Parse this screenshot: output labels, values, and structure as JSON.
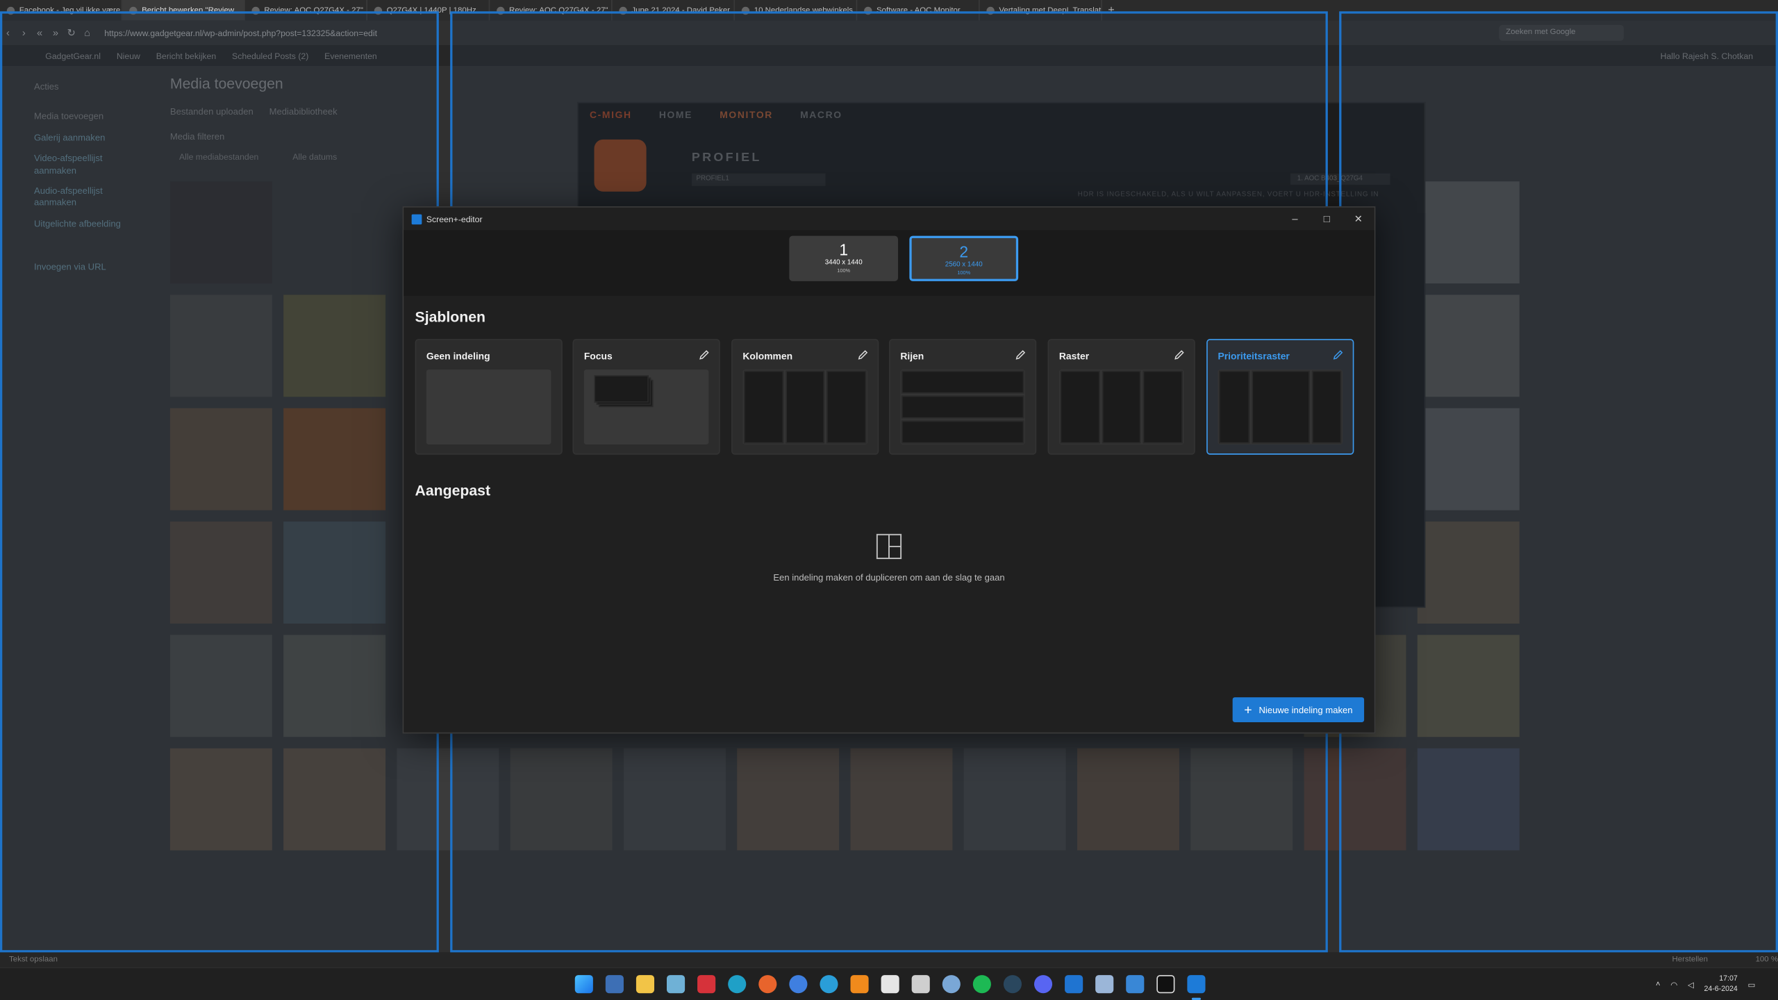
{
  "browser": {
    "tabs": [
      {
        "label": "Facebook - Jeg vil ikke være"
      },
      {
        "label": "Bericht bewerken \"Review"
      },
      {
        "label": "Review: AOC Q27G4X - 27\""
      },
      {
        "label": "Q27G4X | 1440P | 180Hz"
      },
      {
        "label": "Review: AOC Q27G4X - 27\""
      },
      {
        "label": "June 21 2024 - David Peker"
      },
      {
        "label": "10 Nederlandse webwinkels"
      },
      {
        "label": "Software - AOC Monitor"
      },
      {
        "label": "Vertaling met DeepL Translate"
      }
    ],
    "tab_add": "+",
    "url": "https://www.gadgetgear.nl/wp-admin/post.php?post=132325&action=edit",
    "search_placeholder": "Zoeken met Google"
  },
  "wp": {
    "bar_items": [
      "GadgetGear.nl",
      "Nieuw",
      "Bericht bekijken",
      "Scheduled Posts (2)",
      "Evenementen"
    ],
    "greeting": "Hallo Rajesh S. Chotkan",
    "sidebar": [
      "Acties",
      "Media toevoegen",
      "Galerij aanmaken",
      "Video-afspeellijst aanmaken",
      "Audio-afspeellijst aanmaken",
      "Uitgelichte afbeelding",
      "Invoegen via URL"
    ],
    "title": "Media toevoegen",
    "tabs": [
      "Bestanden uploaden",
      "Mediabibliotheek"
    ],
    "filter_label": "Media filteren",
    "filter_type": "Alle mediabestanden",
    "filter_date": "Alle datums",
    "status_left": "Tekst opslaan",
    "zoom_label": "Herstellen",
    "zoom_value": "100 %"
  },
  "bgapp": {
    "brand": "C-MIGH",
    "nav": [
      "HOME",
      "MONITOR",
      "MACRO"
    ],
    "profile_title": "PROFIEL",
    "profile_select": "PROFIEL1",
    "monitor_label": "1. AOC B403_Q27G4",
    "note": "HDR IS INGESCHAKELD, ALS U WILT AANPASSEN, VOERT U HDR-INSTELLING IN"
  },
  "editor": {
    "window_title": "Screen+-editor",
    "monitors": [
      {
        "number": "1",
        "resolution": "3440 x 1440",
        "scale": "100%"
      },
      {
        "number": "2",
        "resolution": "2560 x 1440",
        "scale": "100%"
      }
    ],
    "templates_heading": "Sjablonen",
    "templates": [
      {
        "name": "Geen indeling"
      },
      {
        "name": "Focus"
      },
      {
        "name": "Kolommen"
      },
      {
        "name": "Rijen"
      },
      {
        "name": "Raster"
      },
      {
        "name": "Prioriteitsraster"
      }
    ],
    "custom_heading": "Aangepast",
    "empty_text": "Een indeling maken of dupliceren om aan de slag te gaan",
    "new_layout_button": "Nieuwe indeling maken"
  },
  "taskbar": {
    "time": "17:07",
    "date": "24-6-2024",
    "icons": [
      "start-icon",
      "store-icon",
      "file-explorer-icon",
      "photos-icon",
      "vivaldi-icon",
      "edge-icon",
      "firefox-icon",
      "messenger-icon",
      "telegram-icon",
      "vlc-icon",
      "fox-icon",
      "app-icon",
      "globe-icon",
      "spotify-icon",
      "steam-icon",
      "discord-icon",
      "mail-icon",
      "tool-icon",
      "paint-icon",
      "g-hub-icon",
      "fancyzones-icon"
    ]
  },
  "colors": {
    "accent": "#3c9bf0",
    "button": "#1e7ad4",
    "zone_border": "#1e73c9"
  }
}
